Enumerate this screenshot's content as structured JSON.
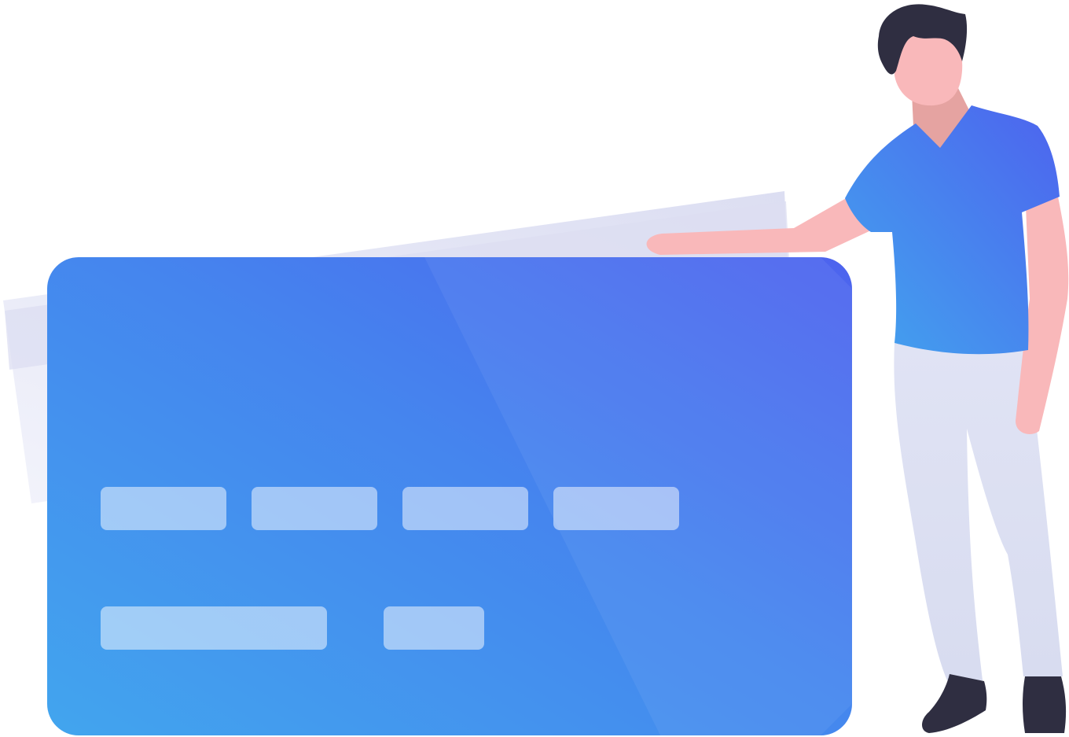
{
  "illustration": {
    "subject": "person-leaning-on-credit-card",
    "colors": {
      "card_gradient_start": "#42A5EE",
      "card_gradient_mid": "#4585EE",
      "card_gradient_end": "#4D63EE",
      "back_card_start": "#F2F3FB",
      "back_card_end": "#DCDEF2",
      "card_field": "#FFFFFF",
      "skin": "#F9B8BA",
      "skin_shadow": "#E5A3A1",
      "hair": "#2F2E41",
      "shoe": "#2F2E41",
      "pants": "#DCE0F2",
      "shirt_start": "#42A5EE",
      "shirt_end": "#4D63EE"
    },
    "card": {
      "number_groups": 4,
      "detail_fields": 2
    }
  }
}
